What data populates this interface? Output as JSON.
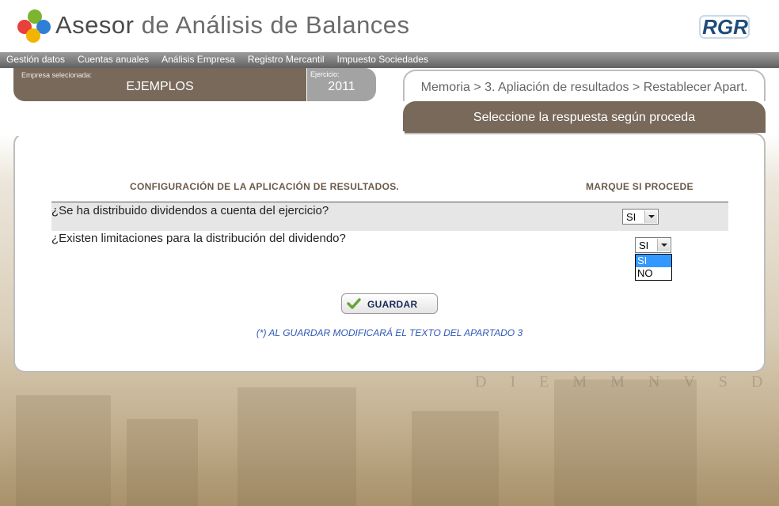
{
  "header": {
    "title_main": "Asesor",
    "title_rest": "de Análisis de Balances",
    "logo_icon": "colored-dots-logo",
    "brand_icon": "rgr-logo"
  },
  "nav": {
    "items": [
      "Gestión datos",
      "Cuentas anuales",
      "Análisis Empresa",
      "Registro Mercantil",
      "Impuesto Sociedades"
    ]
  },
  "empresa": {
    "label": "Empresa selecionada:",
    "value": "EJEMPLOS"
  },
  "ejercicio": {
    "label": "Ejercicio:",
    "value": "2011"
  },
  "breadcrumb": "Memoria > 3. Apliación de resultados > Restablecer Apart.",
  "instruction": "Seleccione la respuesta según proceda",
  "table": {
    "col_config": "CONFIGURACIÓN DE LA APLICACIÓN DE RESULTADOS.",
    "col_mark": "MARQUE SI PROCEDE",
    "rows": [
      {
        "question": "¿Se ha distribuido dividendos a cuenta del ejercicio?",
        "value": "SI"
      },
      {
        "question": "¿Existen limitaciones para la distribución del dividendo?",
        "value": "SI"
      }
    ],
    "dropdown_options": [
      "SI",
      "NO"
    ],
    "dropdown_selected": "SI"
  },
  "save_label": "GUARDAR",
  "note": "(*) AL GUARDAR MODIFICARÁ EL TEXTO DEL APARTADO 3",
  "colors": {
    "brown": "#78695a",
    "grey_tab": "#a3a3a3",
    "note_blue": "#2e58b8",
    "highlight": "#3399ff"
  }
}
